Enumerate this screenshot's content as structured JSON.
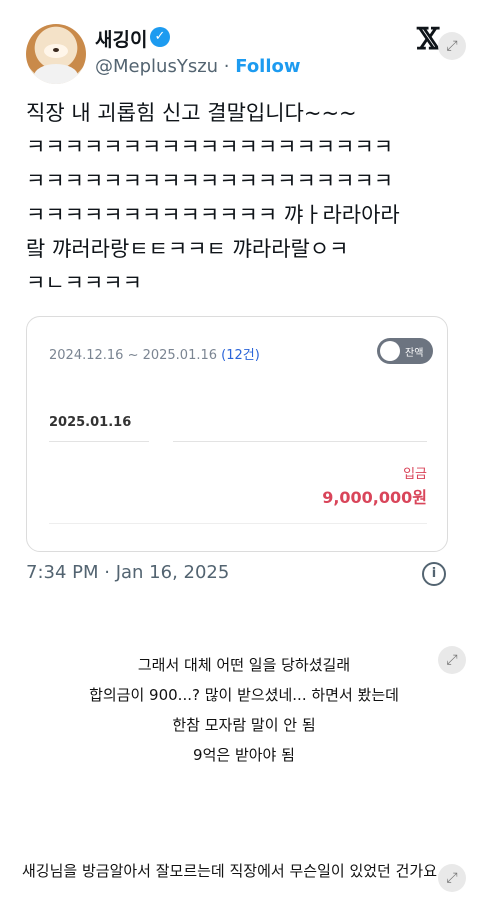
{
  "tweet": {
    "display_name": "새깅이",
    "handle": "@MeplusYszu",
    "separator": "·",
    "follow_label": "Follow",
    "x_logo": "𝕏",
    "verified_icon": "✓",
    "expand_icon": "⤢",
    "text": "직장 내 괴롭힘 신고 결말입니다~~~\nㅋㅋㅋㅋㅋㅋㅋㅋㅋㅋㅋㅋㅋㅋㅋㅋㅋㅋㅋ\nㅋㅋㅋㅋㅋㅋㅋㅋㅋㅋㅋㅋㅋㅋㅋㅋㅋㅋㅋ\nㅋㅋㅋㅋㅋㅋㅋㅋㅋㅋㅋㅋㅋ 꺄ㅏ라라아라\n랔 꺄러라랑ㅌㅌㅋㅋㅌ 꺄라라랄ㅇㅋ\nㅋㄴㅋㅋㅋㅋ",
    "timestamp": "7:34 PM · Jan 16, 2025",
    "info_icon": "i"
  },
  "bank_card": {
    "date_range": "2024.12.16 ~ 2025.01.16",
    "count": "(12건)",
    "toggle_label": "잔액",
    "date": "2025.01.16",
    "type": "입금",
    "amount": "9,000,000원"
  },
  "comment": {
    "lines": [
      "그래서 대체 어떤 일을 당하셨길래",
      "합의금이 900...? 많이 받으셨네... 하면서 봤는데",
      "한참 모자람 말이 안 됨",
      "9억은 받아야 됨"
    ]
  },
  "question": {
    "text": "새깅님을 방금알아서 잘모르는데 직장에서 무슨일이 있었던 건가요...?"
  }
}
